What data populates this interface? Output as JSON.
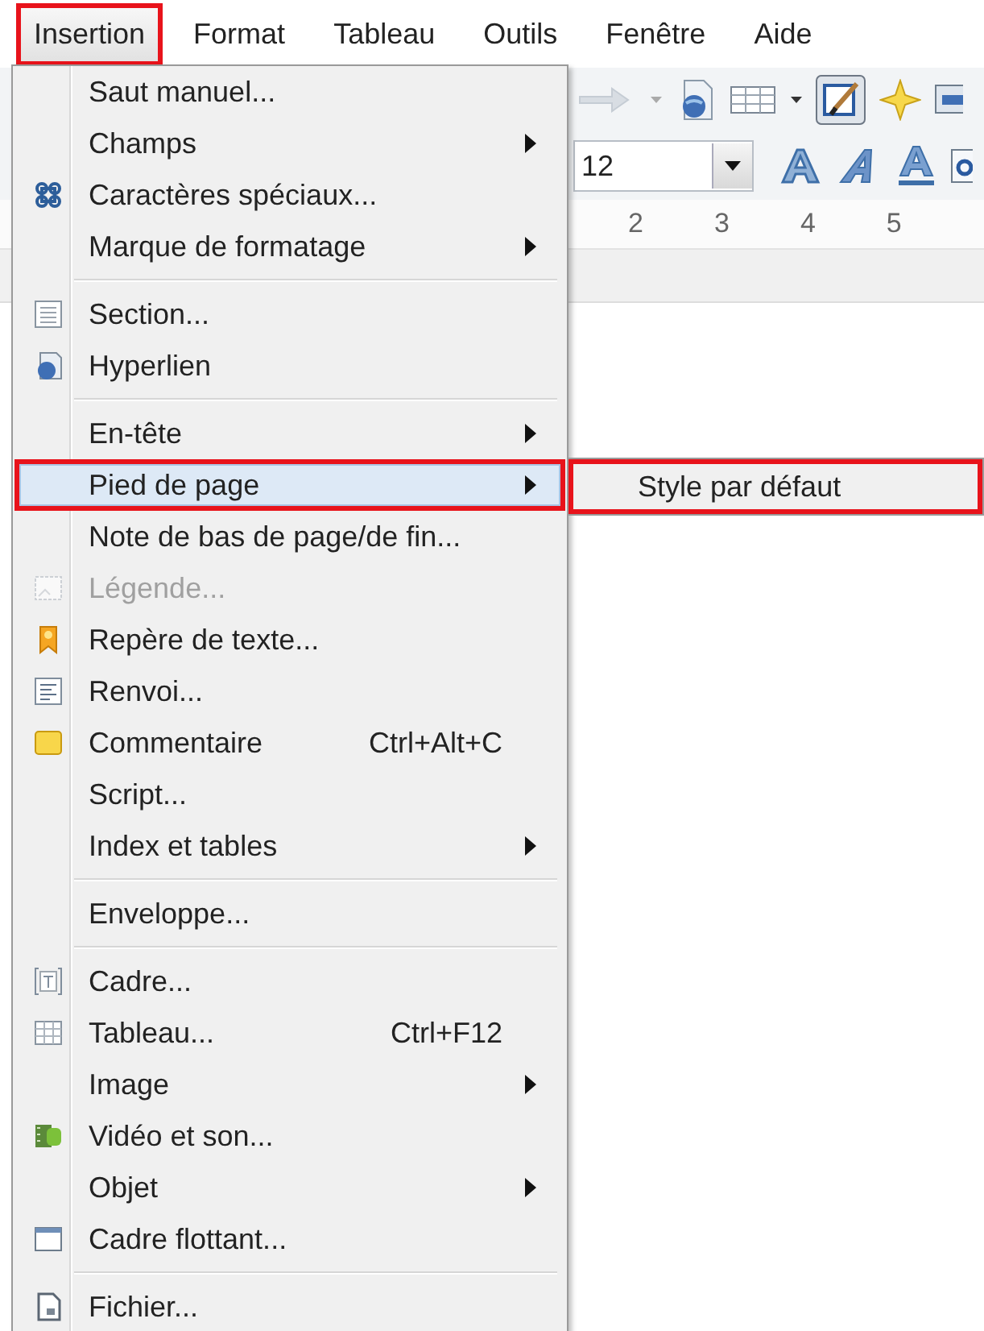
{
  "menubar": [
    {
      "label": "Insertion",
      "selected": true,
      "annotated": true
    },
    {
      "label": "Format",
      "selected": false,
      "annotated": false
    },
    {
      "label": "Tableau",
      "selected": false,
      "annotated": false
    },
    {
      "label": "Outils",
      "selected": false,
      "annotated": false
    },
    {
      "label": "Fenêtre",
      "selected": false,
      "annotated": false
    },
    {
      "label": "Aide",
      "selected": false,
      "annotated": false
    }
  ],
  "toolbar": {
    "font_size": {
      "value": "12"
    }
  },
  "ruler": {
    "marks": [
      "2",
      "3",
      "4",
      "5"
    ]
  },
  "menu": {
    "items": [
      {
        "kind": "item",
        "label": "Saut manuel...",
        "submenu": false,
        "disabled": false,
        "selected": false,
        "annotated": false
      },
      {
        "kind": "item",
        "label": "Champs",
        "submenu": true,
        "disabled": false,
        "selected": false,
        "annotated": false
      },
      {
        "kind": "item",
        "label": "Caractères spéciaux...",
        "submenu": false,
        "disabled": false,
        "selected": false,
        "annotated": false
      },
      {
        "kind": "item",
        "label": "Marque de formatage",
        "submenu": true,
        "disabled": false,
        "selected": false,
        "annotated": false
      },
      {
        "kind": "separator"
      },
      {
        "kind": "item",
        "label": "Section...",
        "submenu": false,
        "disabled": false,
        "selected": false,
        "annotated": false
      },
      {
        "kind": "item",
        "label": "Hyperlien",
        "submenu": false,
        "disabled": false,
        "selected": false,
        "annotated": false
      },
      {
        "kind": "separator"
      },
      {
        "kind": "item",
        "label": "En-tête",
        "submenu": true,
        "disabled": false,
        "selected": false,
        "annotated": false
      },
      {
        "kind": "item",
        "label": "Pied de page",
        "submenu": true,
        "disabled": false,
        "selected": true,
        "annotated": true
      },
      {
        "kind": "item",
        "label": "Note de bas de page/de fin...",
        "submenu": false,
        "disabled": false,
        "selected": false,
        "annotated": false
      },
      {
        "kind": "item",
        "label": "Légende...",
        "submenu": false,
        "disabled": true,
        "selected": false,
        "annotated": false
      },
      {
        "kind": "item",
        "label": "Repère de texte...",
        "submenu": false,
        "disabled": false,
        "selected": false,
        "annotated": false
      },
      {
        "kind": "item",
        "label": "Renvoi...",
        "submenu": false,
        "disabled": false,
        "selected": false,
        "annotated": false
      },
      {
        "kind": "item",
        "label": "Commentaire",
        "shortcut": "Ctrl+Alt+C",
        "submenu": false,
        "disabled": false,
        "selected": false,
        "annotated": false
      },
      {
        "kind": "item",
        "label": "Script...",
        "submenu": false,
        "disabled": false,
        "selected": false,
        "annotated": false
      },
      {
        "kind": "item",
        "label": "Index et tables",
        "submenu": true,
        "disabled": false,
        "selected": false,
        "annotated": false
      },
      {
        "kind": "separator"
      },
      {
        "kind": "item",
        "label": "Enveloppe...",
        "submenu": false,
        "disabled": false,
        "selected": false,
        "annotated": false
      },
      {
        "kind": "separator"
      },
      {
        "kind": "item",
        "label": "Cadre...",
        "submenu": false,
        "disabled": false,
        "selected": false,
        "annotated": false
      },
      {
        "kind": "item",
        "label": "Tableau...",
        "shortcut": "Ctrl+F12",
        "submenu": false,
        "disabled": false,
        "selected": false,
        "annotated": false
      },
      {
        "kind": "item",
        "label": "Image",
        "submenu": true,
        "disabled": false,
        "selected": false,
        "annotated": false
      },
      {
        "kind": "item",
        "label": "Vidéo et son...",
        "submenu": false,
        "disabled": false,
        "selected": false,
        "annotated": false
      },
      {
        "kind": "item",
        "label": "Objet",
        "submenu": true,
        "disabled": false,
        "selected": false,
        "annotated": false
      },
      {
        "kind": "item",
        "label": "Cadre flottant...",
        "submenu": false,
        "disabled": false,
        "selected": false,
        "annotated": false
      },
      {
        "kind": "separator"
      },
      {
        "kind": "item",
        "label": "Fichier...",
        "submenu": false,
        "disabled": false,
        "selected": false,
        "annotated": false
      }
    ]
  },
  "submenu": {
    "items": [
      {
        "label": "Style par défaut",
        "selected": false,
        "annotated": true
      }
    ]
  }
}
